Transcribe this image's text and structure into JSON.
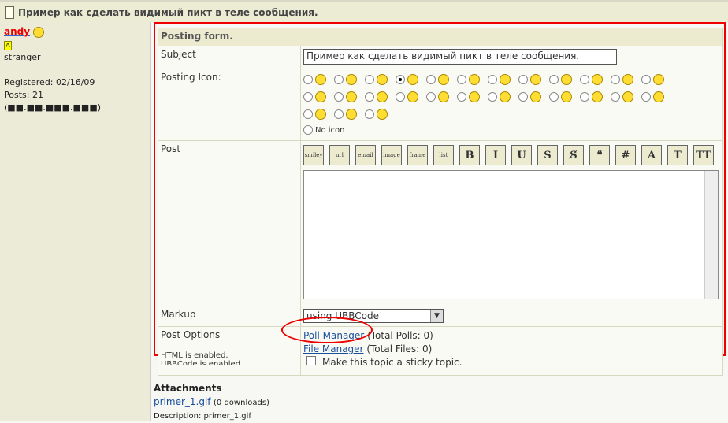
{
  "topic_title": "Пример как сделать видимый пикт в теле сообщения.",
  "user": {
    "name": "andy",
    "badge": "A",
    "rank": "stranger",
    "registered": "Registered: 02/16/09",
    "posts": "Posts: 21",
    "ip": "(■■.■■.■■■.■■■)"
  },
  "form": {
    "header": "Posting form.",
    "subject_label": "Subject",
    "subject_value": "Пример как сделать видимый пикт в теле сообщения.",
    "icon_label": "Posting Icon:",
    "no_icon": "No icon",
    "post_label": "Post",
    "post_value": "_",
    "markup_label": "Markup",
    "markup_value": "using UBBCode",
    "options_label": "Post Options",
    "html_note": "HTML is enabled.",
    "ubb_note": "UBBCode is enabled.",
    "poll_manager": "Poll Manager",
    "poll_count": "(Total Polls: 0)",
    "file_manager": "File Manager",
    "file_count": "(Total Files: 0)",
    "sticky": "Make this topic a sticky topic."
  },
  "toolbar": [
    "smiley",
    "url",
    "email",
    "image",
    "frame",
    "list",
    "B",
    "I",
    "U",
    "S",
    "S̸",
    "❝",
    "#",
    "A",
    "T",
    "TT"
  ],
  "attachments": {
    "title": "Attachments",
    "file": "primer_1.gif",
    "downloads": "(0 downloads)",
    "description": "Description: primer_1.gif"
  }
}
